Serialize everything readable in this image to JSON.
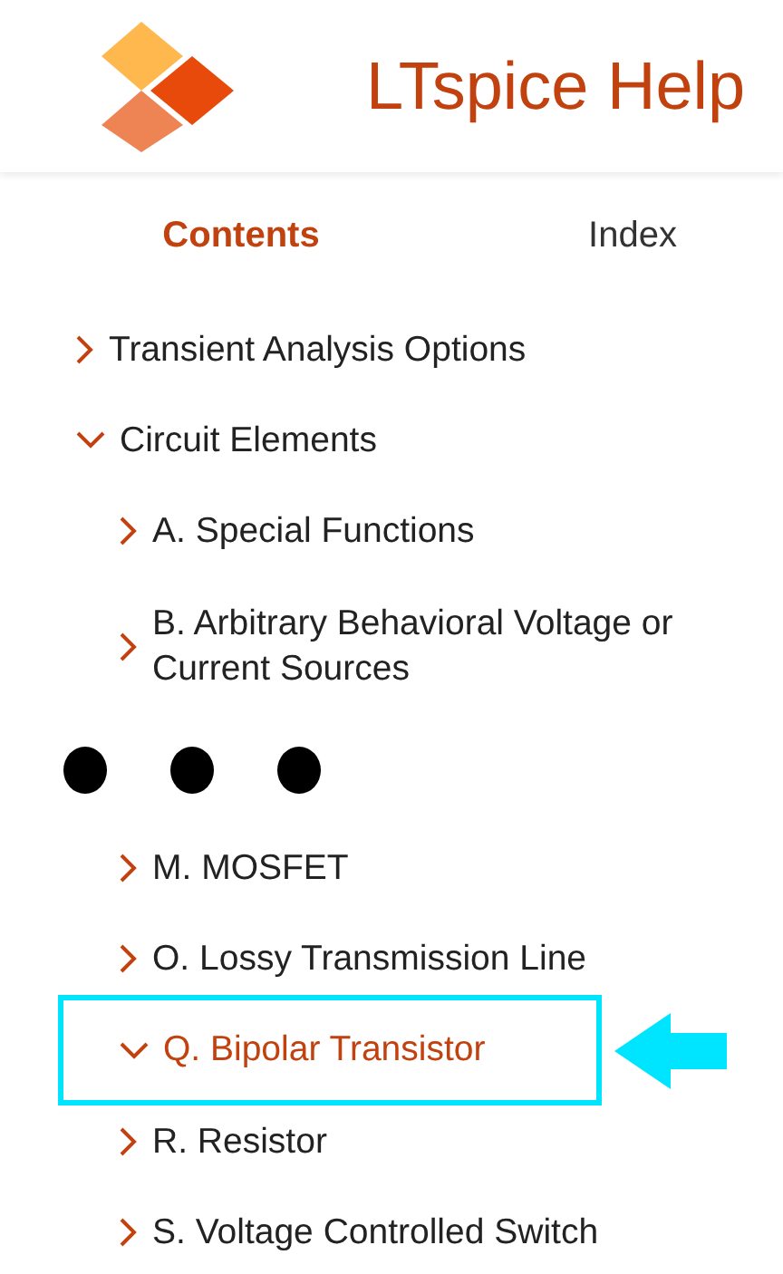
{
  "header": {
    "title": "LTspice Help"
  },
  "tabs": [
    {
      "label": "Contents",
      "selected": true
    },
    {
      "label": "Index",
      "selected": false
    }
  ],
  "tree": [
    {
      "label": "Transient Analysis Options",
      "expanded": false,
      "selected": false
    },
    {
      "label": "Circuit Elements",
      "expanded": true,
      "selected": false,
      "children": [
        {
          "kind": "item",
          "label": "A. Special Functions",
          "expanded": false,
          "selected": false
        },
        {
          "kind": "item",
          "label": "B. Arbitrary Behavioral Voltage or Current Sources",
          "expanded": false,
          "selected": false
        },
        {
          "kind": "ellipsis"
        },
        {
          "kind": "item",
          "label": "M. MOSFET",
          "expanded": false,
          "selected": false
        },
        {
          "kind": "item",
          "label": "O. Lossy Transmission Line",
          "expanded": false,
          "selected": false
        },
        {
          "kind": "item",
          "label": "Q. Bipolar Transistor",
          "expanded": true,
          "selected": true,
          "highlighted": true
        },
        {
          "kind": "item",
          "label": "R. Resistor",
          "expanded": false,
          "selected": false
        },
        {
          "kind": "item",
          "label": "S. Voltage Controlled Switch",
          "expanded": false,
          "selected": false
        }
      ]
    }
  ]
}
